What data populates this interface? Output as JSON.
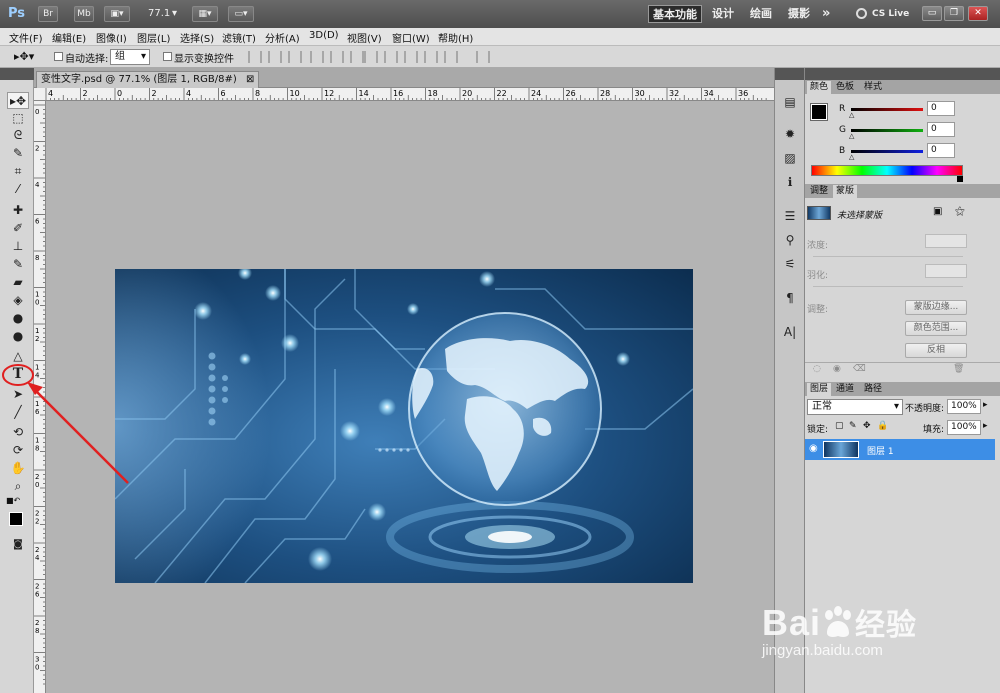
{
  "app": {
    "logo": "Ps",
    "bridge_label": "Br",
    "minibridge_label": "Mb",
    "zoom": "77.1",
    "workspaces": [
      "基本功能",
      "设计",
      "绘画",
      "摄影"
    ],
    "more_label": "»",
    "cslive_label": "CS Live"
  },
  "menu": [
    "文件(F)",
    "编辑(E)",
    "图像(I)",
    "图层(L)",
    "选择(S)",
    "滤镜(T)",
    "分析(A)",
    "3D(D)",
    "视图(V)",
    "窗口(W)",
    "帮助(H)"
  ],
  "options": {
    "auto_select_label": "自动选择:",
    "auto_select_value": "组",
    "show_transform_label": "显示变换控件"
  },
  "document": {
    "tab_title": "变性文字.psd @ 77.1% (图层 1, RGB/8#)",
    "close_label": "⊠",
    "ruler_h": [
      "4",
      "2",
      "0",
      "2",
      "4",
      "6",
      "8",
      "10",
      "12",
      "14",
      "16",
      "18",
      "20",
      "22",
      "24",
      "26",
      "28",
      "30",
      "32",
      "34",
      "36"
    ],
    "ruler_v": [
      "0",
      "2",
      "4",
      "6",
      "8",
      "1 0",
      "1 2",
      "1 4",
      "1 6",
      "1 8",
      "2 0",
      "2 2",
      "2 4",
      "2 6",
      "2 8",
      "3 0"
    ]
  },
  "color_panel": {
    "tabs": [
      "颜色",
      "色板",
      "样式"
    ],
    "channels": [
      {
        "label": "R",
        "value": "0",
        "color": "#e01010"
      },
      {
        "label": "G",
        "value": "0",
        "color": "#10b010"
      },
      {
        "label": "B",
        "value": "0",
        "color": "#1020e0"
      }
    ]
  },
  "adjust_panel": {
    "tabs": [
      "调整",
      "蒙版"
    ],
    "mask_label": "未选择蒙版",
    "density_label": "浓度:",
    "feather_label": "羽化:",
    "refine_label": "调整:",
    "mask_edge_button": "蒙版边缘...",
    "color_range_button": "颜色范围...",
    "invert_button": "反相"
  },
  "layers_panel": {
    "tabs": [
      "图层",
      "通道",
      "路径"
    ],
    "blend_mode": "正常",
    "opacity_label": "不透明度:",
    "opacity_value": "100%",
    "lock_label": "锁定:",
    "fill_label": "填充:",
    "fill_value": "100%",
    "layer_name": "图层 1"
  },
  "watermark": {
    "brand": "Bai",
    "brand_suffix": "经验",
    "url": "jingyan.baidu.com"
  },
  "colors": {
    "accent": "#3d8ee6",
    "annotation": "#e02020"
  }
}
